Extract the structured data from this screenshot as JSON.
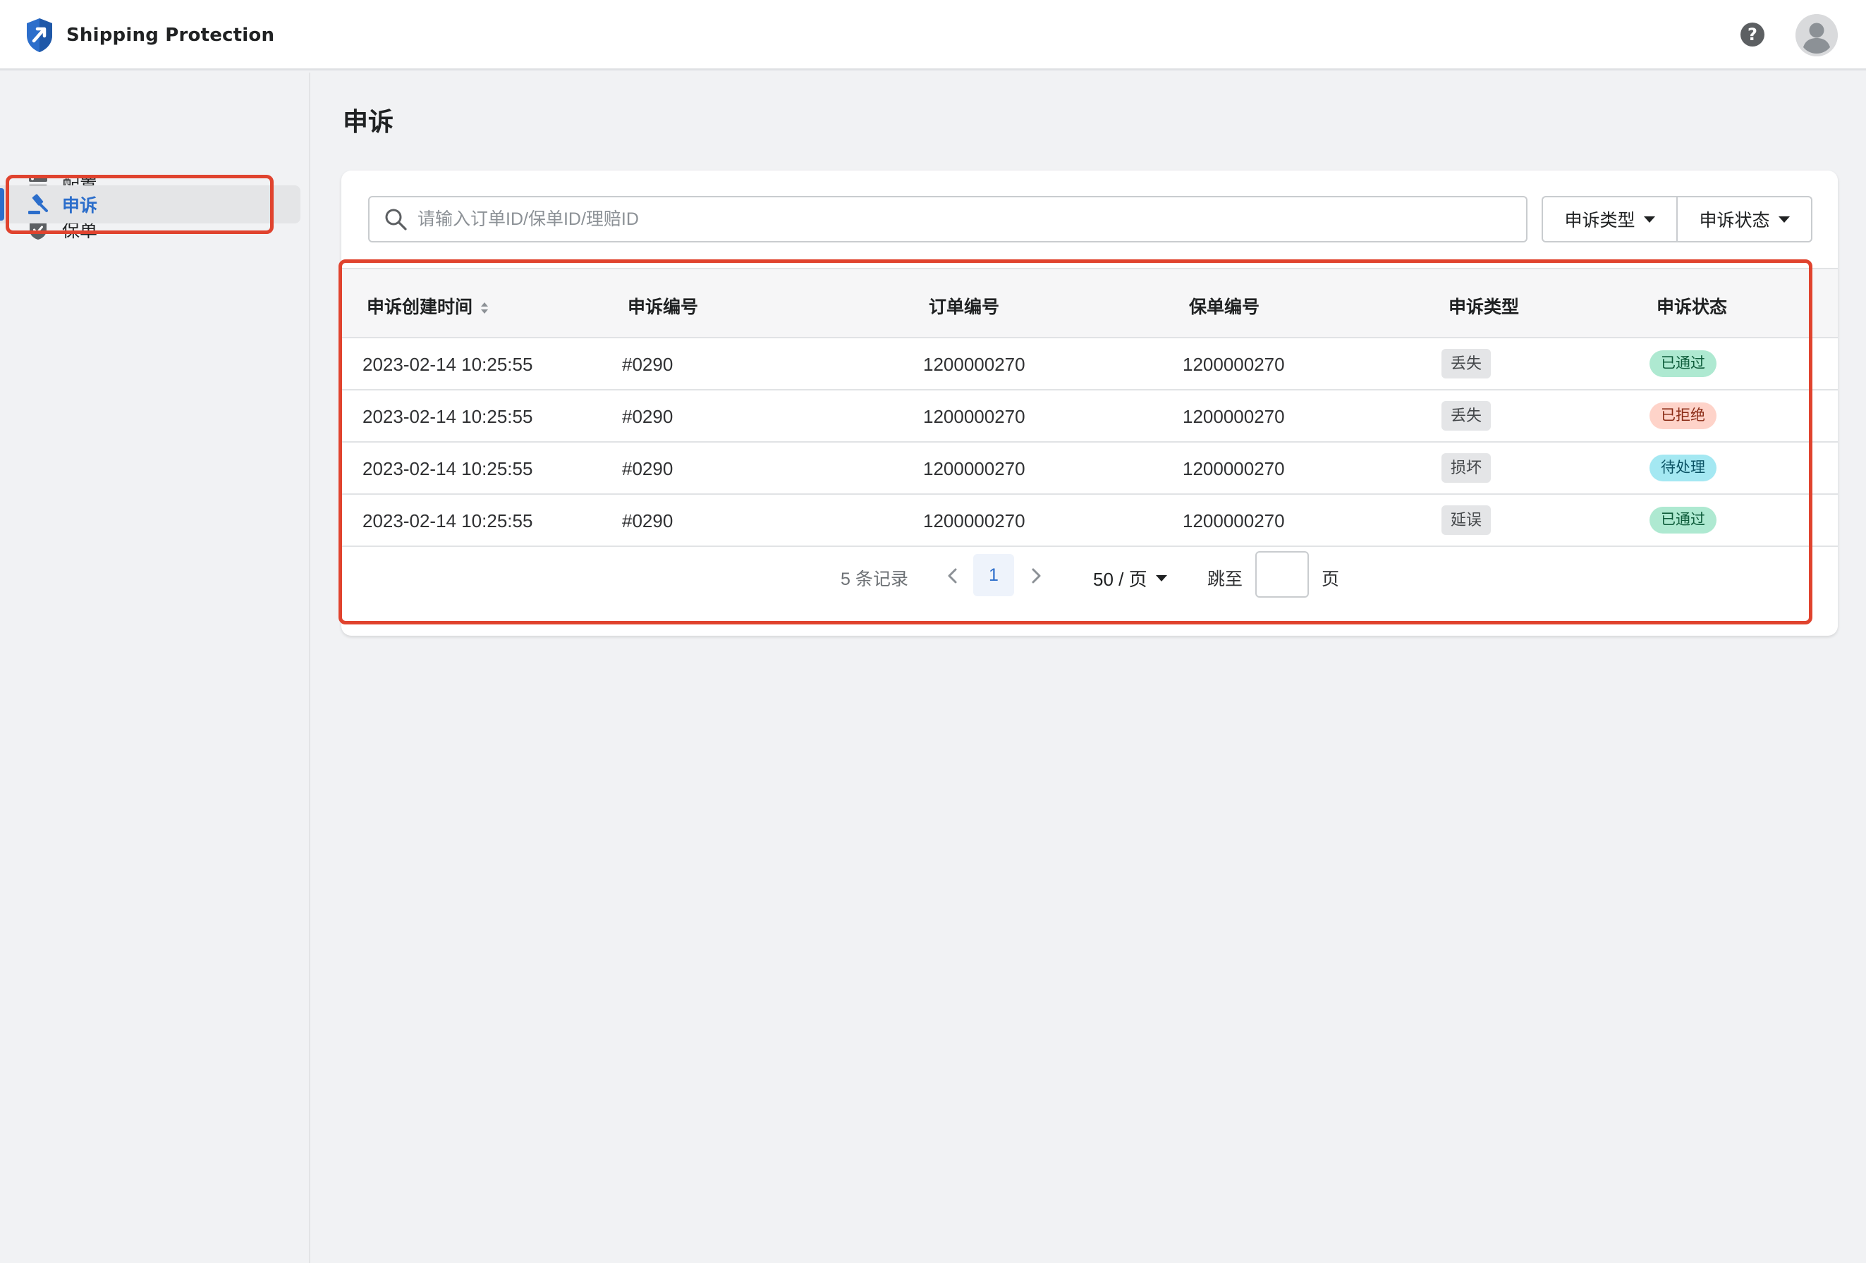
{
  "app": {
    "name": "Shipping Protection"
  },
  "topbar": {
    "help_label": "?"
  },
  "sidebar": {
    "items": [
      {
        "label": "配置",
        "icon": "config-icon"
      },
      {
        "label": "保单",
        "icon": "shield-check-icon"
      },
      {
        "label": "申诉",
        "icon": "gavel-icon",
        "active": true
      }
    ]
  },
  "page": {
    "title": "申诉"
  },
  "search": {
    "placeholder": "请输入订单ID/保单ID/理赔ID",
    "value": ""
  },
  "filters": {
    "type_label": "申诉类型",
    "status_label": "申诉状态"
  },
  "table": {
    "headers": [
      "申诉创建时间",
      "申诉编号",
      "订单编号",
      "保单编号",
      "申诉类型",
      "申诉状态"
    ],
    "rows": [
      {
        "created": "2023-02-14 10:25:55",
        "appeal_no": "#0290",
        "order_no": "1200000270",
        "policy_no": "1200000270",
        "type": "丢失",
        "status": "已通过",
        "status_kind": "ok"
      },
      {
        "created": "2023-02-14 10:25:55",
        "appeal_no": "#0290",
        "order_no": "1200000270",
        "policy_no": "1200000270",
        "type": "丢失",
        "status": "已拒绝",
        "status_kind": "reject"
      },
      {
        "created": "2023-02-14 10:25:55",
        "appeal_no": "#0290",
        "order_no": "1200000270",
        "policy_no": "1200000270",
        "type": "损坏",
        "status": "待处理",
        "status_kind": "pending"
      },
      {
        "created": "2023-02-14 10:25:55",
        "appeal_no": "#0290",
        "order_no": "1200000270",
        "policy_no": "1200000270",
        "type": "延误",
        "status": "已通过",
        "status_kind": "ok"
      }
    ]
  },
  "pagination": {
    "total_text": "5 条记录",
    "current_page": "1",
    "page_size": "50 / 页",
    "jump_label": "跳至",
    "jump_value": "",
    "jump_unit": "页"
  },
  "colors": {
    "accent": "#2c6ecb",
    "annotation": "#e0432e",
    "status_ok": "#aee9d1",
    "status_reject": "#fed3c9",
    "status_pending": "#a4e8f2"
  }
}
